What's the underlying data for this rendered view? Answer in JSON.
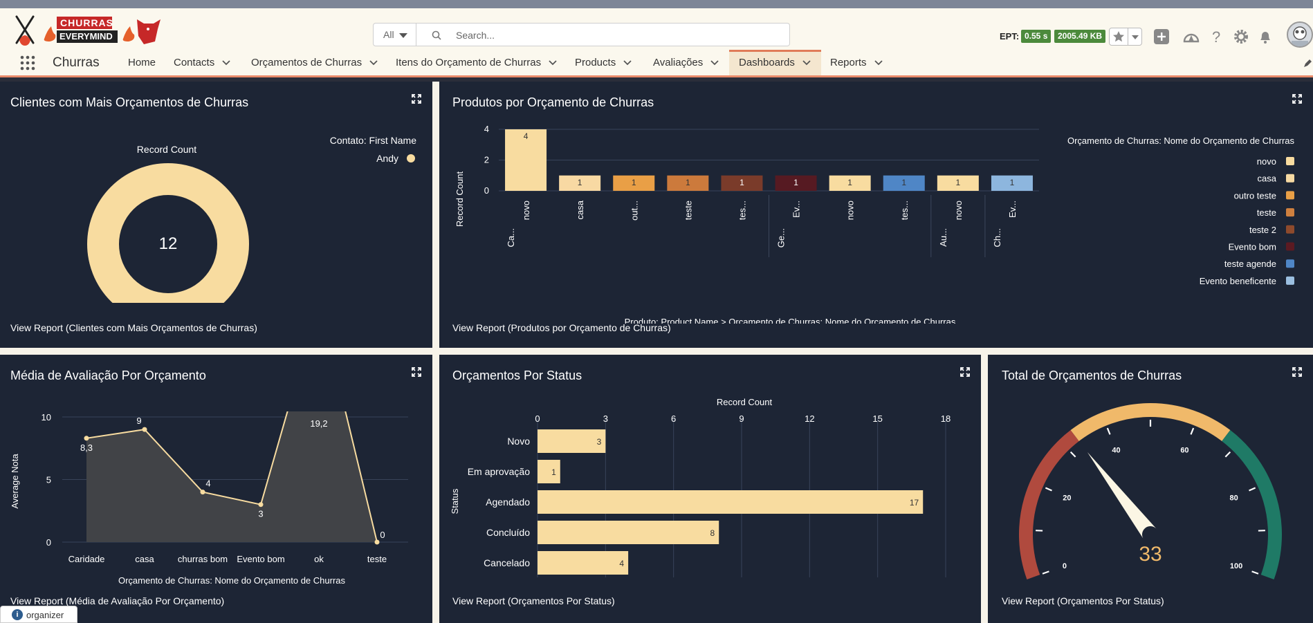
{
  "app": {
    "name": "Churras",
    "logo_text_top": "CHURRAS",
    "logo_text_bottom": "EVERYMIND"
  },
  "search": {
    "scope": "All",
    "placeholder": "Search..."
  },
  "header": {
    "ept_label": "EPT:",
    "ept_time": "0.55 s",
    "ept_size": "2005.49 KB"
  },
  "nav": {
    "items": [
      {
        "label": "Home"
      },
      {
        "label": "Contacts"
      },
      {
        "label": "Orçamentos de Churras"
      },
      {
        "label": "Itens do Orçamento de Churras"
      },
      {
        "label": "Products"
      },
      {
        "label": "Avaliações"
      },
      {
        "label": "Dashboards"
      },
      {
        "label": "Reports"
      }
    ],
    "active": "Dashboards"
  },
  "colors": {
    "panel_bg": "#1d2535",
    "cream": "#f8dca0",
    "accent_active": "#e07b59"
  },
  "panels": {
    "p1": {
      "title": "Clientes com Mais Orçamentos de Churras",
      "view_report": "View Report (Clientes com Mais Orçamentos de Churras)",
      "chart_data": {
        "type": "pie",
        "title": "Record Count",
        "legend_title": "Contato: First Name",
        "total_label": "12",
        "slices": [
          {
            "label": "Andy",
            "value": 12,
            "color": "#f8dca0"
          }
        ]
      }
    },
    "p2": {
      "title": "Produtos por Orçamento de Churras",
      "view_report": "View Report (Produtos por Orçamento de Churras)",
      "chart_data": {
        "type": "bar",
        "ylabel": "Record Count",
        "xlabel": "Produto: Product Name  >  Orçamento de Churras: Nome do Orçamento de Churras",
        "legend_title": "Orçamento de Churras: Nome do Orçamento de Churras",
        "ylim": [
          0,
          4
        ],
        "yticks": [
          "0",
          "2",
          "4"
        ],
        "bars": [
          {
            "label": "novo",
            "value": 4,
            "color": "#f8dca0",
            "group": 0
          },
          {
            "label": "casa",
            "value": 1,
            "color": "#f8d9a3",
            "group": 0
          },
          {
            "label": "out...",
            "value": 1,
            "color": "#e99f46",
            "group": 0
          },
          {
            "label": "teste",
            "value": 1,
            "color": "#cc7a3c",
            "group": 0
          },
          {
            "label": "tes...",
            "value": 1,
            "color": "#7a3b2a",
            "group": 0
          },
          {
            "label": "Ev...",
            "value": 1,
            "color": "#561a22",
            "group": 1
          },
          {
            "label": "novo",
            "value": 1,
            "color": "#f8dca0",
            "group": 1
          },
          {
            "label": "tes...",
            "value": 1,
            "color": "#4f86c6",
            "group": 1
          },
          {
            "label": "novo",
            "value": 1,
            "color": "#f8dca0",
            "group": 2
          },
          {
            "label": "Ev...",
            "value": 1,
            "color": "#8db6de",
            "group": 3
          }
        ],
        "groups": [
          "Ca...",
          "Ge...",
          "Au...",
          "Ch..."
        ],
        "legend": [
          {
            "label": "novo",
            "color": "#f8dca0"
          },
          {
            "label": "casa",
            "color": "#f6d9a2"
          },
          {
            "label": "outro teste",
            "color": "#e99f46"
          },
          {
            "label": "teste",
            "color": "#cf803f"
          },
          {
            "label": "teste 2",
            "color": "#8e4a2c"
          },
          {
            "label": "Evento bom",
            "color": "#5b1a22"
          },
          {
            "label": "teste agende",
            "color": "#4f86c6"
          },
          {
            "label": "Evento beneficente",
            "color": "#9bbfe0"
          }
        ]
      }
    },
    "p3": {
      "title": "Média de Avaliação Por Orçamento",
      "view_report": "View Report (Média de Avaliação Por Orçamento)",
      "chart_data": {
        "type": "area",
        "ylabel": "Average Nota",
        "xlabel": "Orçamento de Churras: Nome do Orçamento de Churras",
        "ylim": [
          0,
          10
        ],
        "yticks": [
          "0",
          "5",
          "10"
        ],
        "categories": [
          "Caridade",
          "casa",
          "churras bom",
          "Evento bom",
          "ok",
          "teste"
        ],
        "values": [
          8.3,
          9,
          4,
          3,
          19.2,
          0
        ],
        "value_labels": [
          "8,3",
          "9",
          "4",
          "3",
          "19,2",
          "0"
        ]
      }
    },
    "p4": {
      "title": "Orçamentos Por Status",
      "view_report": "View Report (Orçamentos Por Status)",
      "chart_data": {
        "type": "bar",
        "orientation": "horizontal",
        "xlabel": "Record Count",
        "ylabel": "Status",
        "xlim": [
          0,
          18
        ],
        "xticks": [
          "0",
          "3",
          "6",
          "9",
          "12",
          "15",
          "18"
        ],
        "categories": [
          "Novo",
          "Em aprovação",
          "Agendado",
          "Concluído",
          "Cancelado"
        ],
        "values": [
          3,
          1,
          17,
          8,
          4
        ]
      }
    },
    "p5": {
      "title": "Total de Orçamentos de Churras",
      "view_report": "View Report (Orçamentos Por Status)",
      "chart_data": {
        "type": "gauge",
        "value": 33,
        "value_label": "33",
        "min": 0,
        "max": 100,
        "ticks": [
          "0",
          "20",
          "40",
          "60",
          "80",
          "100"
        ],
        "bands": [
          {
            "from": 0,
            "to": 33,
            "color": "#b04a3e"
          },
          {
            "from": 33,
            "to": 67,
            "color": "#f0b96a"
          },
          {
            "from": 67,
            "to": 100,
            "color": "#1f7a66"
          }
        ]
      }
    }
  },
  "footer": {
    "organizer_label": "organizer"
  }
}
